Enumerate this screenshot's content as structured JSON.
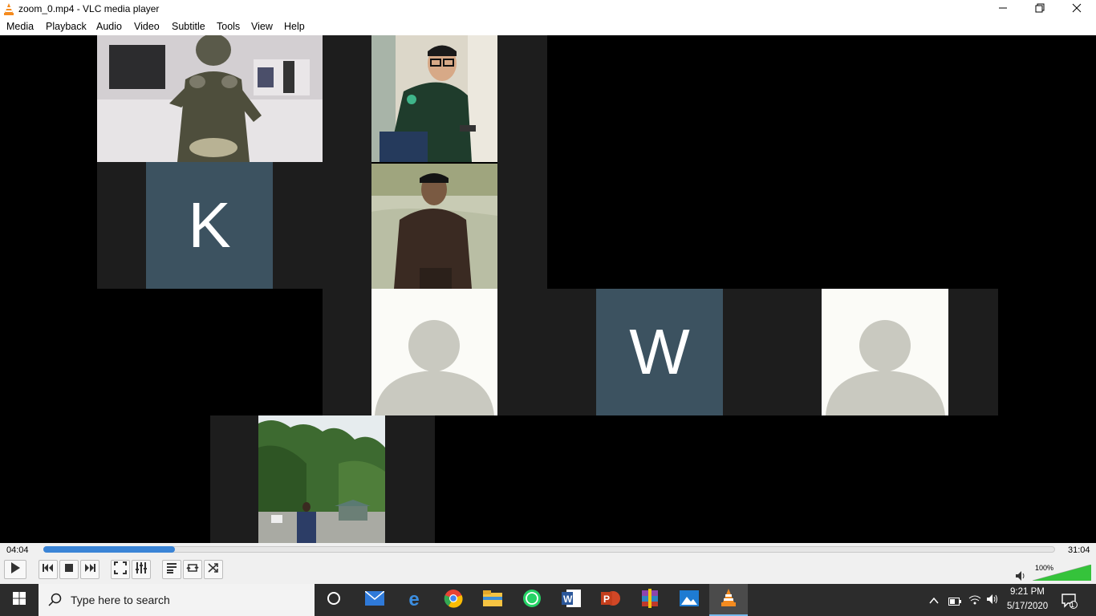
{
  "window": {
    "title": "zoom_0.mp4 - VLC media player",
    "minimize_icon": "minimize-icon",
    "maximize_icon": "restore-icon",
    "close_icon": "close-icon"
  },
  "menu": [
    "Media",
    "Playback",
    "Audio",
    "Video",
    "Subtitle",
    "Tools",
    "View",
    "Help"
  ],
  "video": {
    "tiles": [
      {
        "kind": "camera",
        "desc": "person-in-camouflage"
      },
      {
        "kind": "camera",
        "desc": "young-man-with-glasses"
      },
      {
        "kind": "initial",
        "letter": "K"
      },
      {
        "kind": "camera",
        "desc": "man-by-lake"
      },
      {
        "kind": "placeholder-avatar"
      },
      {
        "kind": "initial",
        "letter": "W"
      },
      {
        "kind": "placeholder-avatar"
      },
      {
        "kind": "camera",
        "desc": "person-in-forest"
      }
    ],
    "tile_k_letter": "K",
    "tile_w_letter": "W"
  },
  "playback": {
    "elapsed": "04:04",
    "total": "31:04",
    "progress_fraction": 0.13,
    "volume_percent": "100%",
    "volume_level": 1.0
  },
  "controls": {
    "buttons": [
      "play",
      "previous",
      "stop",
      "next",
      "fullscreen",
      "extended-settings",
      "playlist",
      "loop",
      "random"
    ]
  },
  "taskbar": {
    "search_placeholder": "Type here to search",
    "time": "9:21 PM",
    "date": "5/17/2020",
    "notification_count": "1",
    "apps": [
      "task-view",
      "mail",
      "edge",
      "chrome",
      "file-explorer",
      "whatsapp",
      "word",
      "powerpoint",
      "winrar",
      "photos",
      "vlc"
    ]
  },
  "colors": {
    "accent": "#3a84d6",
    "tile_slate": "#3c5260",
    "tile_dark": "#1d1d1d",
    "avatar_bg": "#fbfbf7",
    "avatar_fg": "#c9c9c0",
    "vlc_orange": "#f48b1f"
  }
}
